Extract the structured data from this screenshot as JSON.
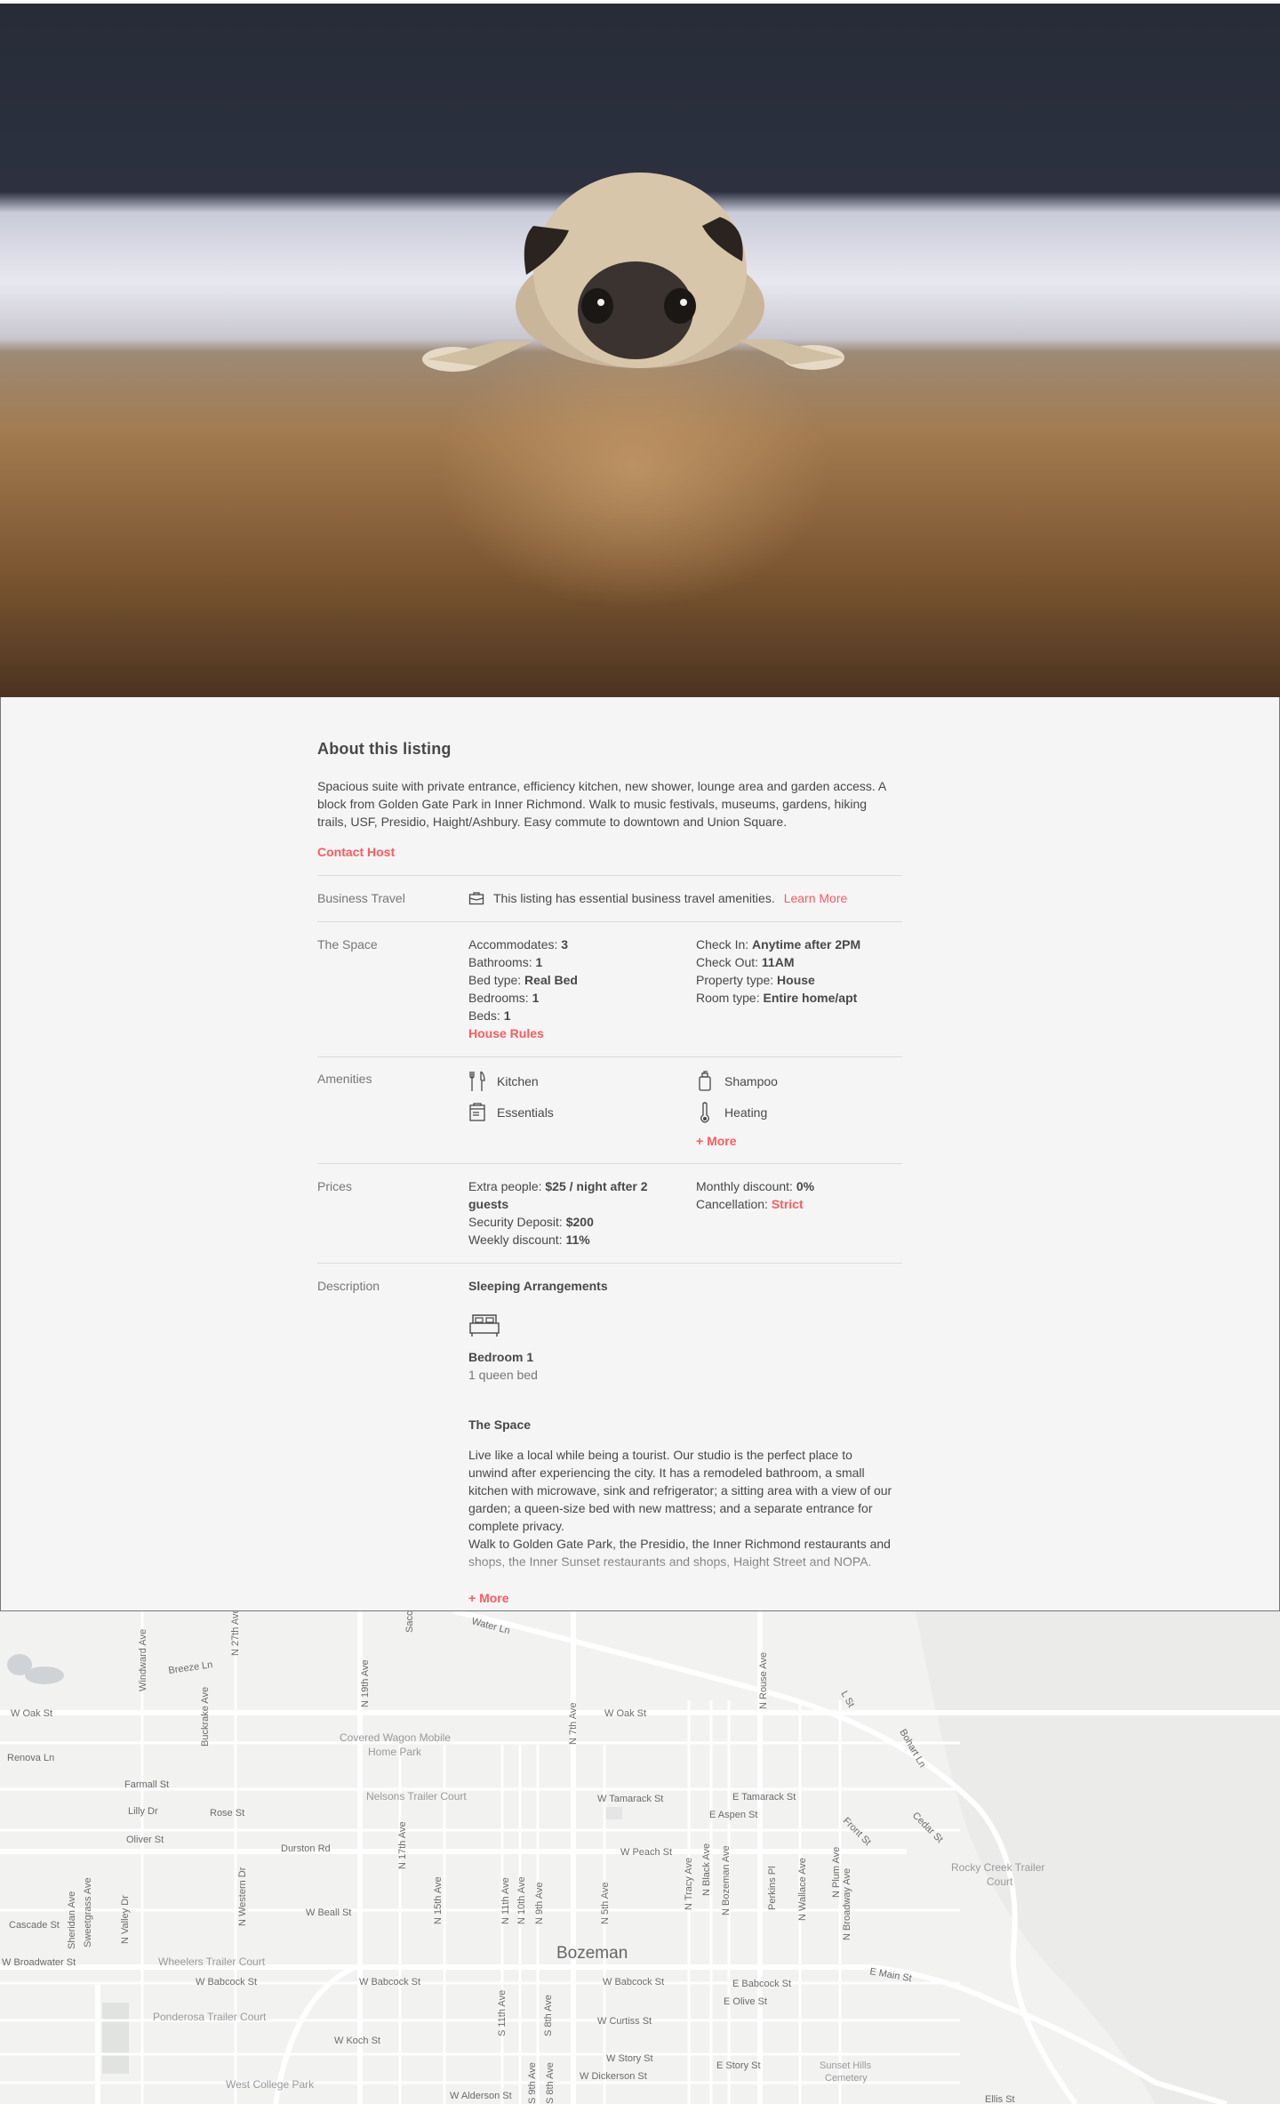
{
  "about": {
    "title": "About this listing",
    "description": "Spacious suite with private entrance, efficiency kitchen, new shower, lounge area and garden access. A block from Golden Gate Park in Inner Richmond. Walk to music festivals, museums, gardens, hiking trails, USF, Presidio, Haight/Ashbury. Easy commute to downtown and Union Square.",
    "contact_label": "Contact Host"
  },
  "business": {
    "label": "Business Travel",
    "text": "This listing has essential business travel amenities.",
    "link": "Learn More"
  },
  "space": {
    "label": "The Space",
    "left": [
      {
        "key": "Accommodates:",
        "value": "3"
      },
      {
        "key": "Bathrooms:",
        "value": "1"
      },
      {
        "key": "Bed type:",
        "value": "Real Bed"
      },
      {
        "key": "Bedrooms:",
        "value": "1"
      },
      {
        "key": "Beds:",
        "value": "1"
      }
    ],
    "right": [
      {
        "key": "Check In:",
        "value": "Anytime after 2PM"
      },
      {
        "key": "Check Out:",
        "value": "11AM"
      },
      {
        "key": "Property type:",
        "value": "House"
      },
      {
        "key": "Room type:",
        "value": "Entire home/apt"
      }
    ],
    "house_rules": "House Rules"
  },
  "amenities": {
    "label": "Amenities",
    "items": [
      {
        "name": "Kitchen",
        "icon": "kitchen-icon"
      },
      {
        "name": "Shampoo",
        "icon": "shampoo-icon"
      },
      {
        "name": "Essentials",
        "icon": "essentials-icon"
      },
      {
        "name": "Heating",
        "icon": "thermometer-icon"
      }
    ],
    "more": "+ More"
  },
  "prices": {
    "label": "Prices",
    "extra_key": "Extra people:",
    "extra_value_1": "$25 / night after 2",
    "extra_value_2": "guests",
    "deposit_key": "Security Deposit:",
    "deposit_value": "$200",
    "weekly_key": "Weekly discount:",
    "weekly_value": "11%",
    "monthly_key": "Monthly discount:",
    "monthly_value": "0%",
    "cancel_key": "Cancellation:",
    "cancel_value": "Strict"
  },
  "description": {
    "label": "Description",
    "sleeping_title": "Sleeping Arrangements",
    "bedroom_title": "Bedroom 1",
    "bedroom_beds": "1 queen bed",
    "space_title": "The Space",
    "space_text_1": "Live like a local while being a tourist. Our studio is the perfect place to unwind after experiencing the city. It has a remodeled bathroom, a small kitchen with microwave, sink and refrigerator; a sitting area with a view of our garden; a queen-size bed with new mattress; and a separate entrance for complete privacy.",
    "space_text_2": "Walk to Golden Gate Park, the Presidio, the Inner Richmond restaurants and shops, the Inner Sunset restaurants and shops, Haight Street and NOPA.",
    "more": "+ More"
  },
  "map": {
    "city": "Bozeman",
    "labels": {
      "woak_w": "W Oak St",
      "woak_e": "W Oak St",
      "renova": "Renova Ln",
      "farmall": "Farmall St",
      "lilly": "Lilly Dr",
      "rose": "Rose St",
      "oliver": "Oliver St",
      "durston": "Durston Rd",
      "wbeall": "W Beall St",
      "cascade": "Cascade St",
      "wbroadwater": "W Broadwater St",
      "wbabcock1": "W Babcock St",
      "wbabcock2": "W Babcock St",
      "wbabcock3": "W Babcock St",
      "ebabcock": "E Babcock St",
      "eolive": "E Olive St",
      "wcurtiss": "W Curtiss St",
      "wkoch": "W Koch St",
      "wstory": "W Story St",
      "wdickerson": "W Dickerson St",
      "estory": "E Story St",
      "walderson": "W Alderson St",
      "wtamarack": "W Tamarack St",
      "etamarack": "E Tamarack St",
      "easpen": "E Aspen St",
      "wpeach": "W Peach St",
      "emain": "E Main St",
      "ellis": "Ellis St",
      "breeze": "Breeze Ln",
      "n27": "N 27th Ave",
      "n19": "N 19th Ave",
      "n17": "N 17th Ave",
      "n15": "N 15th Ave",
      "n11": "N 11th Ave",
      "n10": "N 10th Ave",
      "n9": "N 9th Ave",
      "n7": "N 7th Ave",
      "n5": "N 5th Ave",
      "nrouse": "N Rouse Ave",
      "nblack": "N Black Ave",
      "ntracy": "N Tracy Ave",
      "nbozeman": "N Bozeman Ave",
      "perkins": "Perkins Pl",
      "nwallace": "N Wallace Ave",
      "nplum": "N Plum Ave",
      "nbroadway": "N Broadway Ave",
      "lst": "L St",
      "bohart": "Bohart Ln",
      "cedar": "Cedar St",
      "front": "Front St",
      "windward": "Windward Ave",
      "buckrake": "Buckrake Ave",
      "sheridan": "Sheridan Ave",
      "sweetgrass": "Sweetgrass Ave",
      "nvalley": "N Valley Dr",
      "nwestern": "N Western Dr",
      "s11": "S 11th Ave",
      "s8": "S 8th Ave",
      "s9": "S 9th Ave",
      "s8b": "S 8th Ave",
      "water": "Water Ln",
      "sacco": "Sacco",
      "covered1": "Covered Wagon Mobile",
      "covered2": "Home Park",
      "nelsons": "Nelsons Trailer Court",
      "wheelers": "Wheelers Trailer Court",
      "ponderosa": "Ponderosa Trailer Court",
      "westcollege": "West College Park",
      "rocky1": "Rocky Creek Trailer",
      "rocky2": "Court",
      "sunset1": "Sunset Hills",
      "sunset2": "Cemetery"
    }
  }
}
